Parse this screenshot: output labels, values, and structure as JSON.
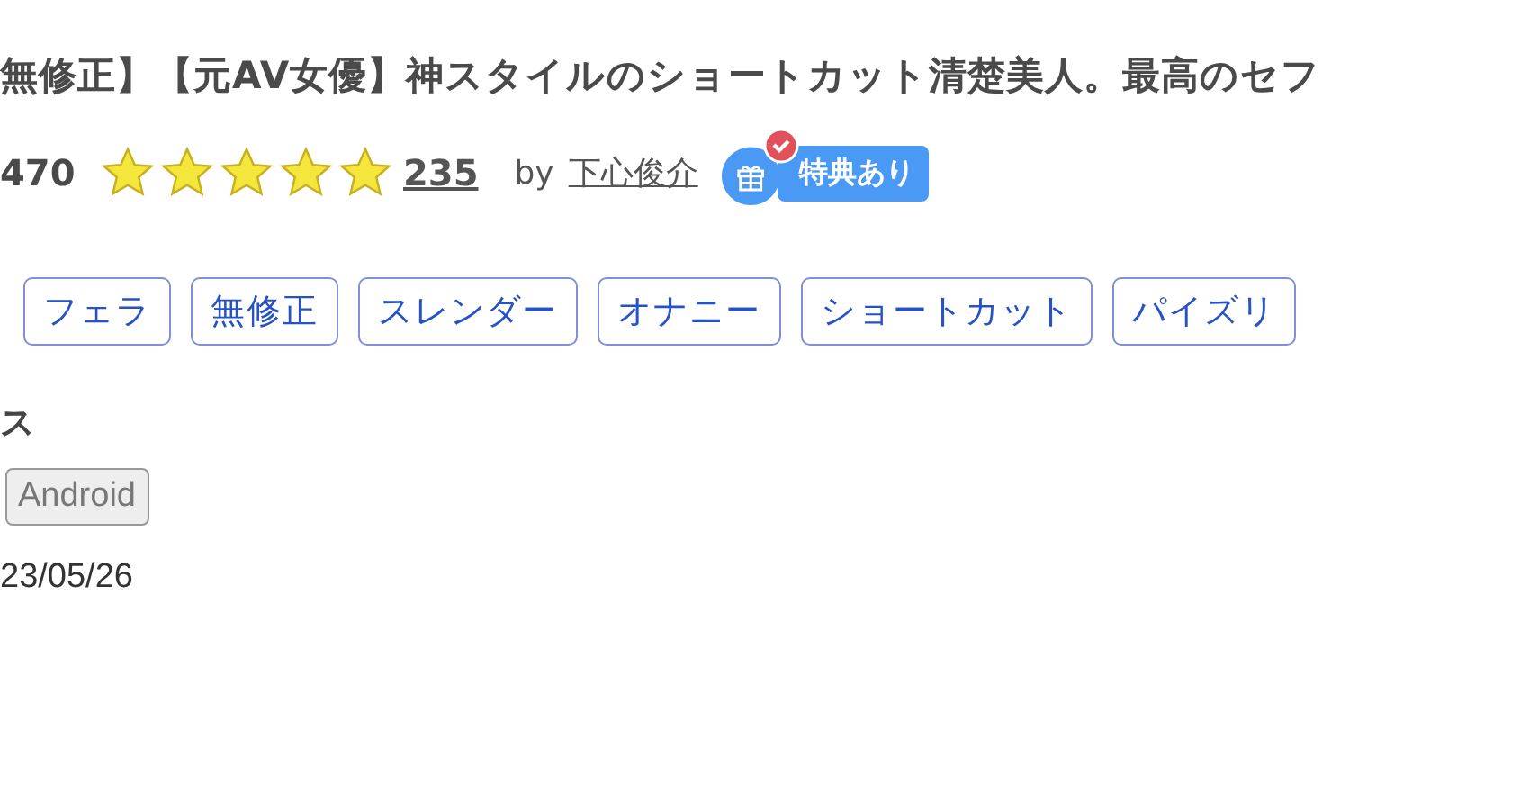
{
  "title": "無修正】【元AV女優】神スタイルのショートカット清楚美人。最高のセフ",
  "price": "470",
  "rating": {
    "stars": 5,
    "count": "235"
  },
  "author": {
    "by": "by",
    "name": "下心俊介"
  },
  "badge": {
    "label": "特典あり"
  },
  "tags": [
    "フェラ",
    "無修正",
    "スレンダー",
    "オナニー",
    "ショートカット",
    "パイズリ"
  ],
  "section_label": "ス",
  "platforms": [
    {
      "label": "Android",
      "selected": false
    }
  ],
  "date": "23/05/26"
}
